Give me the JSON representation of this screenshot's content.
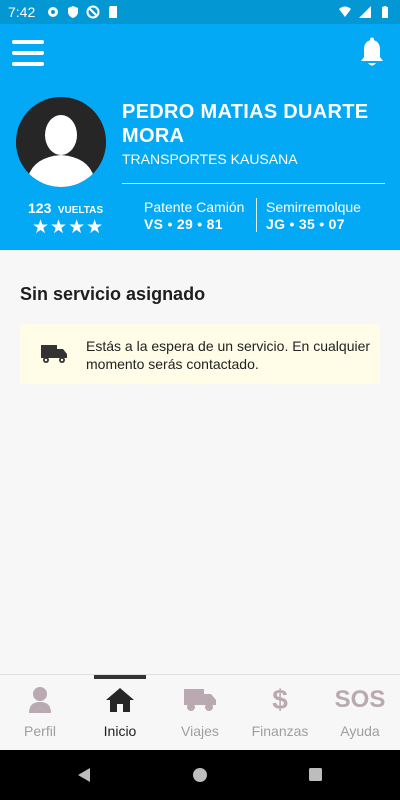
{
  "status_bar": {
    "time": "7:42"
  },
  "colors": {
    "primary": "#03a9f4",
    "status_bar": "#0398d4",
    "notice_bg": "#fffde7",
    "nav_inactive": "#9e9e9e",
    "nav_active": "#1e1e1e"
  },
  "header": {
    "menu_icon": "hamburger-menu-icon",
    "bell_icon": "bell-icon",
    "driver_name": "PEDRO MATIAS DUARTE MORA",
    "company": "TRANSPORTES KAUSANA",
    "turns_count": "123",
    "turns_label": "VUELTAS",
    "stars": "★★★★",
    "truck_plate_label": "Patente Camión",
    "truck_plate_value": "VS • 29 • 81",
    "trailer_label": "Semirremolque",
    "trailer_value": "JG • 35 • 07"
  },
  "main": {
    "title": "Sin servicio asignado",
    "notice_icon": "truck-icon",
    "notice_text": "Estás a la espera de un servicio. En cualquier momento serás contactado."
  },
  "bottom_nav": {
    "items": [
      {
        "label": "Perfil",
        "icon": "person-icon"
      },
      {
        "label": "Inicio",
        "icon": "home-icon",
        "active": true
      },
      {
        "label": "Viajes",
        "icon": "truck-icon"
      },
      {
        "label": "Finanzas",
        "icon": "dollar-icon",
        "glyph": "$"
      },
      {
        "label": "Ayuda",
        "icon": "sos-icon",
        "glyph": "SOS"
      }
    ]
  },
  "system_nav": {
    "back_icon": "back-icon",
    "home_icon": "home-circle-icon",
    "recents_icon": "recents-icon"
  }
}
